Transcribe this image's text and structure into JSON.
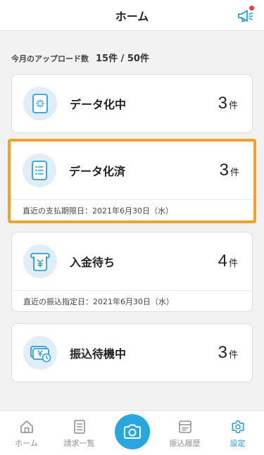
{
  "header": {
    "title": "ホーム",
    "notice_icon": "megaphone-icon",
    "notice_color": "#2a9fd8",
    "badge_color": "#e8423f"
  },
  "upload": {
    "label": "今月のアップロード数",
    "value": "15件 / 50件"
  },
  "cards": [
    {
      "label": "データ化中",
      "count": "3",
      "unit": "件",
      "icon": "loading-icon"
    },
    {
      "label": "データ化済",
      "count": "3",
      "unit": "件",
      "icon": "document-list-icon",
      "sub": "直近の支払期限日：2021年6月30日（水）"
    },
    {
      "label": "入金待ち",
      "count": "4",
      "unit": "件",
      "icon": "yen-receipt-icon",
      "sub": "直近の振込指定日：2021年6月30日（水）"
    },
    {
      "label": "振込待機中",
      "count": "3",
      "unit": "件",
      "icon": "yen-card-clock-icon"
    }
  ],
  "tabs": [
    {
      "label": "ホーム",
      "icon": "home-icon",
      "active": false
    },
    {
      "label": "請求一覧",
      "icon": "invoice-list-icon",
      "active": false
    },
    {
      "label": "振込履歴",
      "icon": "transfer-history-icon",
      "active": false
    },
    {
      "label": "設定",
      "icon": "gear-icon",
      "active": true
    }
  ],
  "camera": {
    "icon": "camera-icon"
  },
  "colors": {
    "accent": "#27a6df",
    "highlight": "#f5a02b",
    "icon_bg": "#e2eef7"
  }
}
